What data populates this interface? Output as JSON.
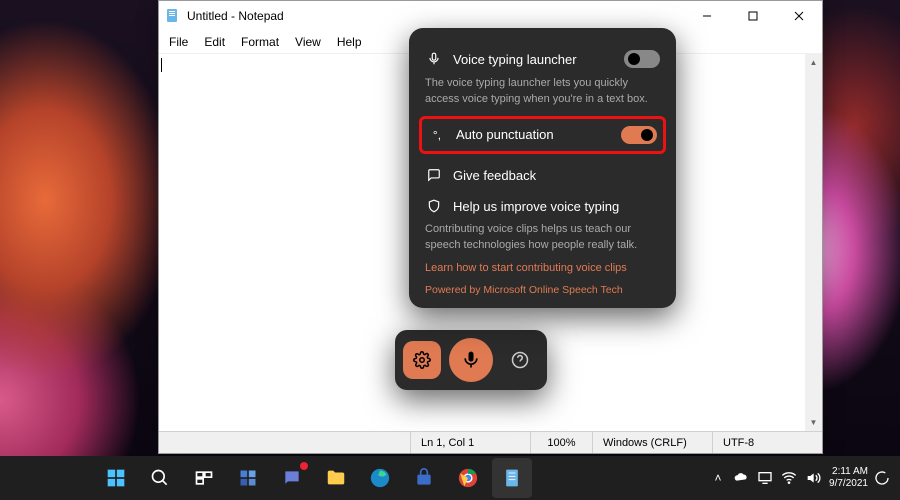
{
  "window": {
    "title": "Untitled - Notepad",
    "menu": {
      "file": "File",
      "edit": "Edit",
      "format": "Format",
      "view": "View",
      "help": "Help"
    }
  },
  "statusbar": {
    "line_col": "Ln 1, Col 1",
    "zoom": "100%",
    "line_ending": "Windows (CRLF)",
    "encoding": "UTF-8"
  },
  "voice_typing": {
    "launcher": {
      "label": "Voice typing launcher",
      "desc": "The voice typing launcher lets you quickly access voice typing when you're in a text box.",
      "enabled": false
    },
    "auto_punct": {
      "label": "Auto punctuation",
      "enabled": true
    },
    "feedback": {
      "label": "Give feedback"
    },
    "improve": {
      "label": "Help us improve voice typing",
      "desc": "Contributing voice clips helps us teach our speech technologies how people really talk.",
      "link": "Learn how to start contributing voice clips"
    },
    "powered": "Powered by Microsoft Online Speech Tech"
  },
  "system_tray": {
    "time": "2:11 AM",
    "date": "9/7/2021"
  },
  "colors": {
    "accent": "#e07a52",
    "highlight_border": "#e11"
  }
}
